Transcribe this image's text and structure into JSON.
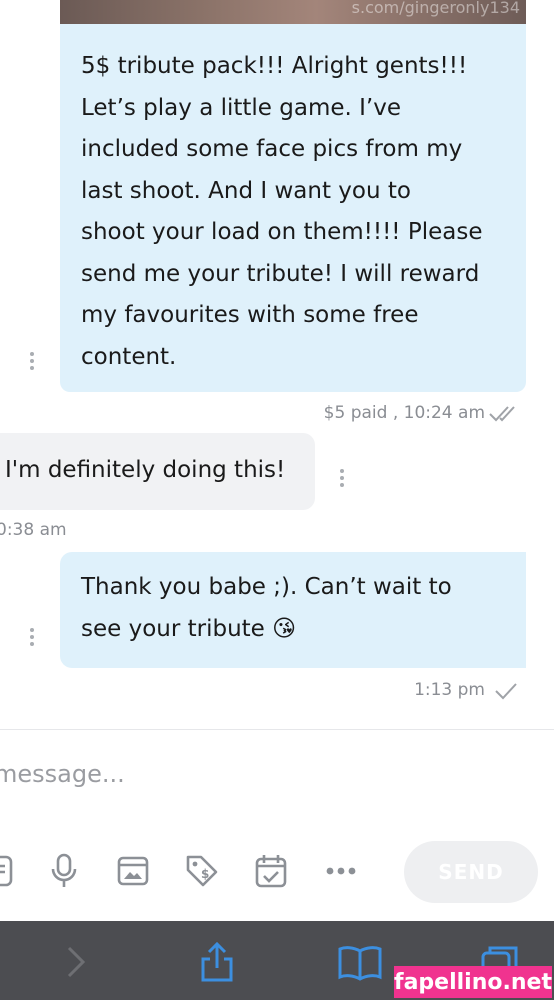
{
  "top_image": {
    "watermark": "s.com/gingeronly134"
  },
  "messages": [
    {
      "direction": "outgoing",
      "lines": [
        "5$ tribute pack!!! Alright gents!!!",
        "Let’s play a little game. I’ve",
        "included some face pics from my",
        "last shoot. And I want you to",
        "shoot your load on them!!!! Please",
        "send me your tribute! I will reward",
        "my favourites with some free",
        "content."
      ],
      "meta": "$5 paid , 10:24 am",
      "status": "read"
    },
    {
      "direction": "incoming",
      "lines": [
        "I'm definitely doing this!"
      ],
      "meta": "0:38 am"
    },
    {
      "direction": "outgoing",
      "lines": [
        "Thank you babe ;). Can’t wait to",
        "see your tribute 😘"
      ],
      "meta": "1:13 pm",
      "status": "sent"
    }
  ],
  "composer": {
    "placeholder": "message...",
    "send_label": "SEND",
    "tools": [
      "attach-icon",
      "microphone-icon",
      "image-icon",
      "price-tag-icon",
      "calendar-check-icon",
      "more-icon"
    ]
  },
  "browser_bar": {
    "icons": [
      "forward-arrow-icon",
      "share-icon",
      "bookmarks-icon",
      "tabs-icon"
    ]
  },
  "watermark_badge": "fapellino.net",
  "colors": {
    "outgoing_bubble": "#dff1fb",
    "incoming_bubble": "#f1f2f4",
    "accent_blue": "#2e86d6",
    "badge": "#f0338f"
  }
}
